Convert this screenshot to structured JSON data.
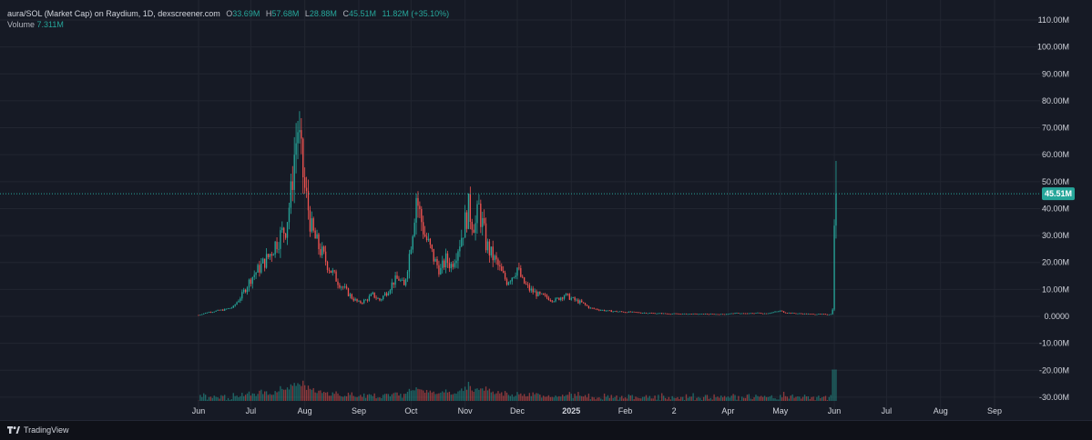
{
  "legend": {
    "symbol": "aura/SOL (Market Cap) on Raydium, 1D, dexscreener.com",
    "open_label": "O",
    "open": "33.69M",
    "high_label": "H",
    "high": "57.68M",
    "low_label": "L",
    "low": "28.88M",
    "close_label": "C",
    "close": "45.51M",
    "change": "11.82M (+35.10%)",
    "volume_label": "Volume",
    "volume": "7.311M"
  },
  "price_tag": "45.51M",
  "branding": "TradingView",
  "colors": {
    "up": "#26a69a",
    "down": "#ef5350",
    "grid": "#222631",
    "axis_text": "#d1d4dc",
    "background": "#161a25",
    "price_line": "#26a69a"
  },
  "chart_data": {
    "type": "candlestick",
    "title": "",
    "y_ticks": [
      "110.00M",
      "100.00M",
      "90.00M",
      "80.00M",
      "70.00M",
      "60.00M",
      "50.00M",
      "40.00M",
      "30.00M",
      "20.00M",
      "10.00M",
      "0.0000",
      "-10.00M",
      "-20.00M",
      "-30.00M"
    ],
    "y_tick_values": [
      110,
      100,
      90,
      80,
      70,
      60,
      50,
      40,
      30,
      20,
      10,
      0,
      -10,
      -20,
      -30
    ],
    "ylim": [
      -30,
      110
    ],
    "y_unit": "M",
    "x_ticks": [
      "Jun",
      "Jul",
      "Aug",
      "Sep",
      "Oct",
      "Nov",
      "Dec",
      "2025",
      "Feb",
      "2",
      "Apr",
      "May",
      "Jun",
      "Jul",
      "Aug",
      "Sep"
    ],
    "x_tick_days": [
      0,
      30,
      61,
      92,
      122,
      153,
      183,
      214,
      245,
      273,
      304,
      334,
      365,
      395,
      426,
      457
    ],
    "x_origin": "Jun",
    "anchors": [
      [
        0,
        0.5
      ],
      [
        5,
        1.5
      ],
      [
        10,
        2.0
      ],
      [
        15,
        2.5
      ],
      [
        20,
        3.5
      ],
      [
        25,
        8
      ],
      [
        30,
        14
      ],
      [
        35,
        18
      ],
      [
        40,
        22
      ],
      [
        45,
        28
      ],
      [
        50,
        33
      ],
      [
        53,
        45
      ],
      [
        55,
        60
      ],
      [
        57,
        70
      ],
      [
        59,
        58
      ],
      [
        61,
        47
      ],
      [
        63,
        40
      ],
      [
        65,
        32
      ],
      [
        68,
        27
      ],
      [
        72,
        22
      ],
      [
        76,
        17
      ],
      [
        80,
        13
      ],
      [
        84,
        10
      ],
      [
        88,
        7
      ],
      [
        92,
        5
      ],
      [
        96,
        6
      ],
      [
        100,
        8
      ],
      [
        104,
        6
      ],
      [
        108,
        9
      ],
      [
        112,
        13
      ],
      [
        115,
        14
      ],
      [
        118,
        11
      ],
      [
        121,
        23
      ],
      [
        123,
        33
      ],
      [
        125,
        45
      ],
      [
        127,
        38
      ],
      [
        130,
        30
      ],
      [
        133,
        25
      ],
      [
        136,
        20
      ],
      [
        139,
        17
      ],
      [
        142,
        21
      ],
      [
        145,
        19
      ],
      [
        148,
        24
      ],
      [
        151,
        30
      ],
      [
        153,
        35
      ],
      [
        155,
        40
      ],
      [
        157,
        36
      ],
      [
        159,
        34
      ],
      [
        161,
        40
      ],
      [
        163,
        34
      ],
      [
        165,
        27
      ],
      [
        168,
        23
      ],
      [
        171,
        20
      ],
      [
        174,
        16
      ],
      [
        177,
        13
      ],
      [
        180,
        15
      ],
      [
        183,
        18
      ],
      [
        186,
        13
      ],
      [
        190,
        10
      ],
      [
        195,
        8
      ],
      [
        200,
        7
      ],
      [
        205,
        6
      ],
      [
        210,
        8
      ],
      [
        213,
        7
      ],
      [
        216,
        6
      ],
      [
        220,
        5
      ],
      [
        225,
        3
      ],
      [
        230,
        2.5
      ],
      [
        235,
        2
      ],
      [
        240,
        1.8
      ],
      [
        250,
        1.5
      ],
      [
        260,
        1.2
      ],
      [
        270,
        1.0
      ],
      [
        280,
        0.9
      ],
      [
        290,
        0.9
      ],
      [
        300,
        0.8
      ],
      [
        310,
        1.2
      ],
      [
        315,
        1.0
      ],
      [
        320,
        1.3
      ],
      [
        325,
        1.1
      ],
      [
        330,
        1.5
      ],
      [
        334,
        2.0
      ],
      [
        336,
        1.6
      ],
      [
        340,
        1.2
      ],
      [
        350,
        0.9
      ],
      [
        360,
        0.8
      ],
      [
        363,
        0.8
      ]
    ],
    "last_candles": [
      {
        "o": 0.8,
        "h": 3,
        "l": 0.6,
        "c": 2.5
      },
      {
        "o": 2.5,
        "h": 36,
        "l": 2,
        "c": 33.69
      },
      {
        "o": 33.69,
        "h": 57.68,
        "l": 28.88,
        "c": 45.51
      }
    ],
    "current_close": 45.51
  }
}
